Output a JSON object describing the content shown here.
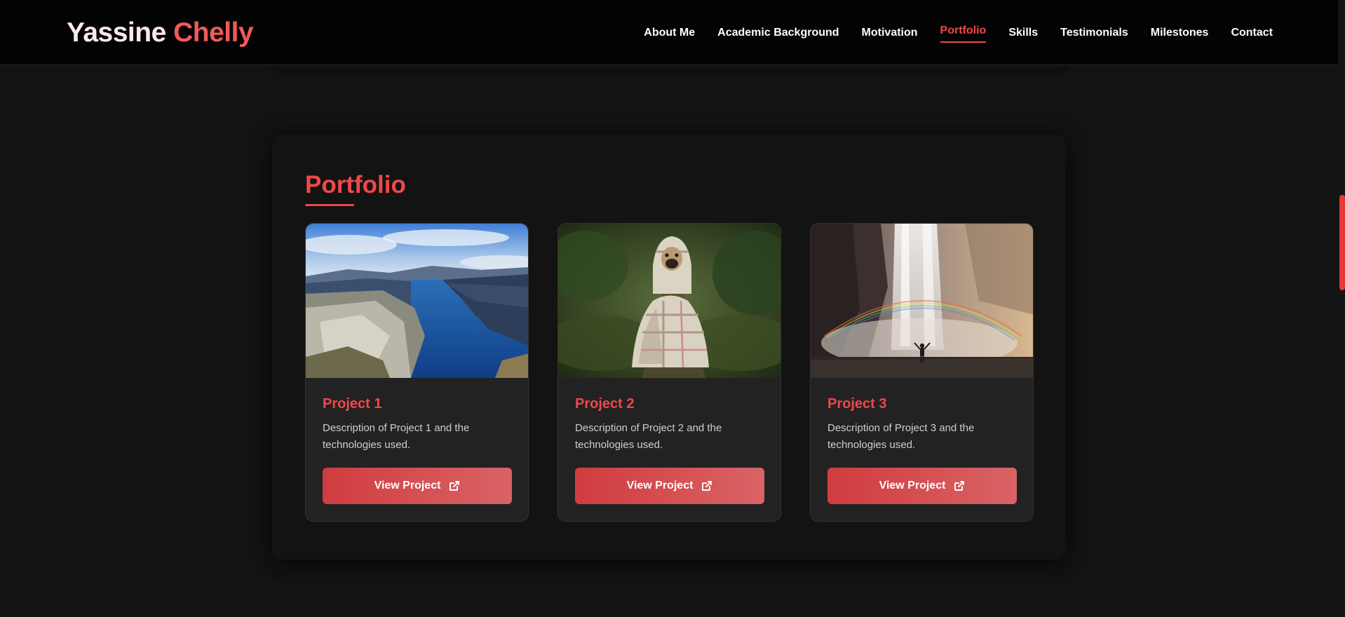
{
  "header": {
    "logo_first": "Yassine",
    "logo_last": "Chelly",
    "nav": [
      {
        "label": "About Me"
      },
      {
        "label": "Academic Background"
      },
      {
        "label": "Motivation"
      },
      {
        "label": "Portfolio",
        "active": true
      },
      {
        "label": "Skills"
      },
      {
        "label": "Testimonials"
      },
      {
        "label": "Milestones"
      },
      {
        "label": "Contact"
      }
    ]
  },
  "portfolio": {
    "title": "Portfolio",
    "projects": [
      {
        "title": "Project 1",
        "description": "Description of Project 1 and the technologies used.",
        "button": "View Project",
        "image": "fjord-landscape"
      },
      {
        "title": "Project 2",
        "description": "Description of Project 2 and the technologies used.",
        "button": "View Project",
        "image": "pug-in-blanket"
      },
      {
        "title": "Project 3",
        "description": "Description of Project 3 and the technologies used.",
        "button": "View Project",
        "image": "waterfall-rainbow"
      }
    ]
  },
  "colors": {
    "accent": "#f04848",
    "background": "#141414",
    "header": "#030303",
    "card": "#222222",
    "button_start": "#d03c3f",
    "button_end": "#d96366"
  },
  "icons": {
    "button_icon": "external-link-icon"
  }
}
